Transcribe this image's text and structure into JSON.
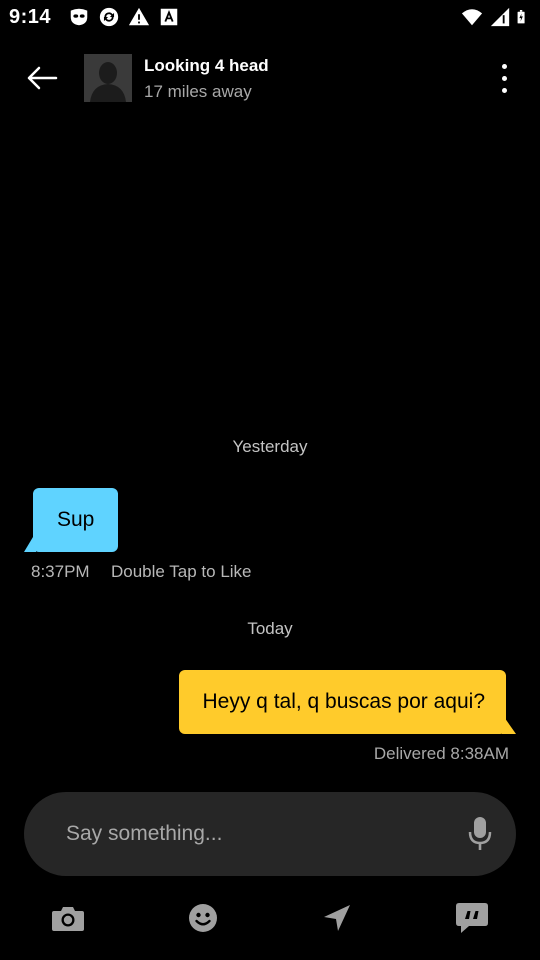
{
  "status_bar": {
    "time": "9:14",
    "left_icons": [
      "grindr-mask-icon",
      "sync-icon",
      "warning-icon",
      "font-icon"
    ],
    "right_icons": [
      "wifi-icon",
      "signal-icon",
      "battery-icon"
    ]
  },
  "header": {
    "name": "Looking 4 head",
    "distance": "17 miles away"
  },
  "messages": {
    "day_yesterday": "Yesterday",
    "received_text": "Sup",
    "received_time": "8:37PM",
    "double_tap_label": "Double Tap to Like",
    "day_today": "Today",
    "sent_text": "Heyy q tal, q buscas por aqui?",
    "sent_status": "Delivered 8:38AM"
  },
  "composer": {
    "placeholder": "Say something..."
  },
  "toolbar": [
    "camera-icon",
    "emoji-icon",
    "location-icon",
    "saved-phrases-icon"
  ],
  "colors": {
    "background": "#000000",
    "received_bubble": "#5fd3ff",
    "sent_bubble": "#ffcb2b",
    "input_background": "#262626",
    "icon_gray": "#a0a0a0"
  }
}
